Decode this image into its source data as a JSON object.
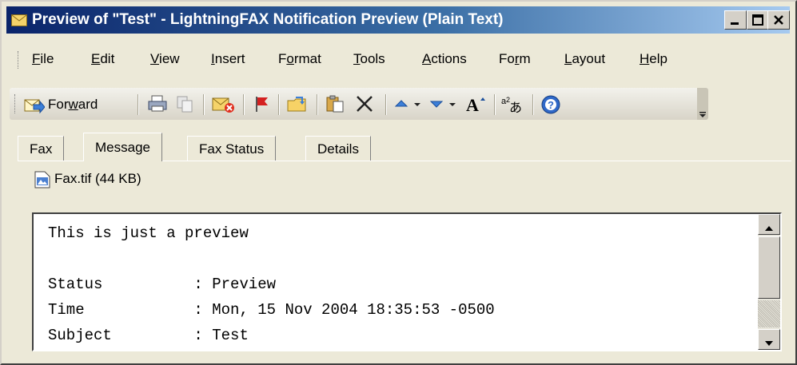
{
  "window": {
    "title": "Preview of \"Test\" - LightningFAX Notification Preview (Plain Text)",
    "title_colors": {
      "start": "#0a246a",
      "end": "#a6caf0"
    }
  },
  "menu": {
    "items": [
      {
        "pre": "",
        "acc": "F",
        "post": "ile"
      },
      {
        "pre": "",
        "acc": "E",
        "post": "dit"
      },
      {
        "pre": "",
        "acc": "V",
        "post": "iew"
      },
      {
        "pre": "",
        "acc": "I",
        "post": "nsert"
      },
      {
        "pre": "F",
        "acc": "o",
        "post": "rmat"
      },
      {
        "pre": "",
        "acc": "T",
        "post": "ools"
      },
      {
        "pre": "",
        "acc": "A",
        "post": "ctions"
      },
      {
        "pre": "Fo",
        "acc": "r",
        "post": "m"
      },
      {
        "pre": "",
        "acc": "L",
        "post": "ayout"
      },
      {
        "pre": "",
        "acc": "H",
        "post": "elp"
      }
    ]
  },
  "toolbar": {
    "forward": {
      "pre": "For",
      "acc": "w",
      "post": "ard"
    },
    "icons": [
      "forward-icon",
      "print-icon",
      "copy-icon",
      "mark-unread-icon",
      "flag-icon",
      "move-to-folder-icon",
      "paste-icon",
      "delete-icon",
      "previous-item-icon",
      "dropdown-arrow",
      "next-item-icon",
      "dropdown-arrow",
      "font-size-icon",
      "encoding-icon",
      "help-icon"
    ]
  },
  "tabs": [
    {
      "label": "Fax",
      "active": false
    },
    {
      "label": "Message",
      "active": true
    },
    {
      "label": "Fax Status",
      "active": false
    },
    {
      "label": "Details",
      "active": false
    }
  ],
  "attachment": {
    "label": "Fax.tif (44 KB)"
  },
  "message_body": {
    "lines": [
      "This is just a preview",
      "",
      "Status          : Preview",
      "Time            : Mon, 15 Nov 2004 18:35:53 -0500",
      "Subject         : Test"
    ]
  }
}
